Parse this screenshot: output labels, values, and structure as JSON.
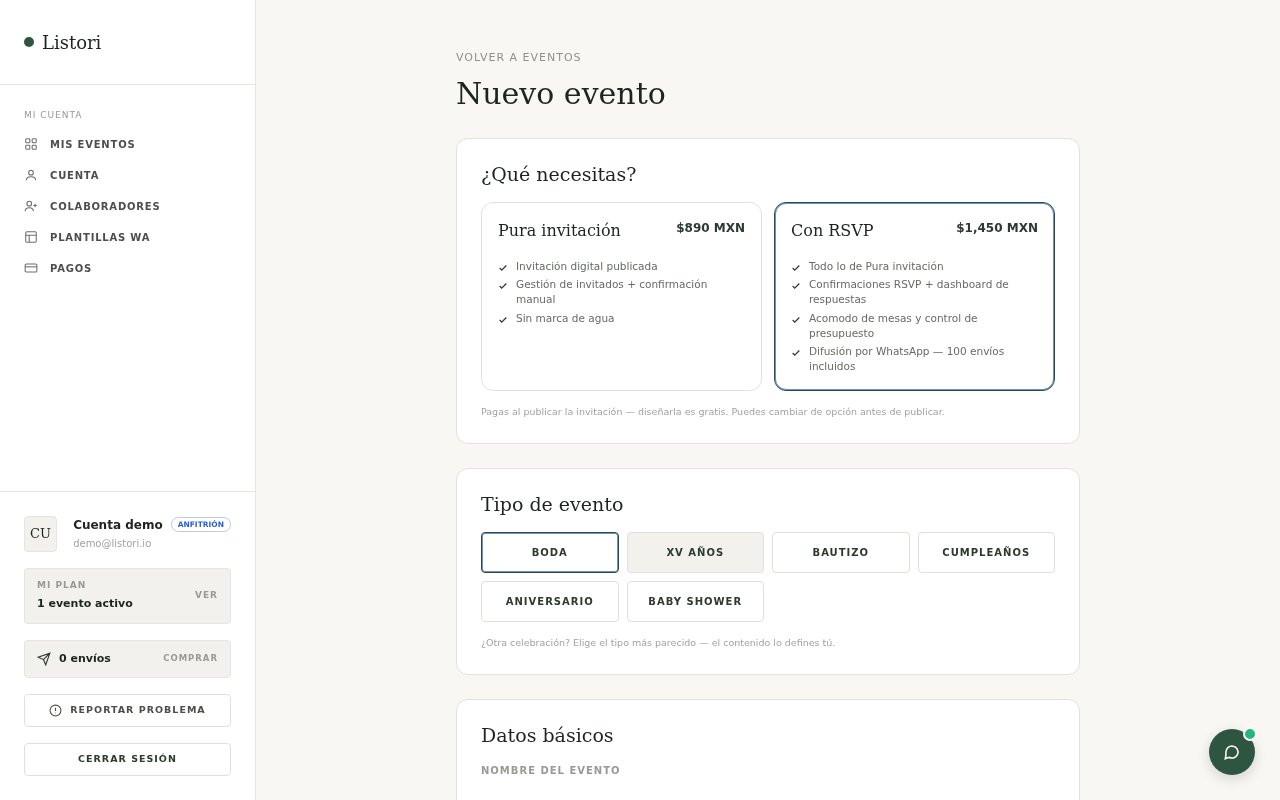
{
  "brand": {
    "name": "Listori"
  },
  "sidebar": {
    "section": "MI CUENTA",
    "items": [
      {
        "label": "MIS EVENTOS"
      },
      {
        "label": "CUENTA"
      },
      {
        "label": "COLABORADORES"
      },
      {
        "label": "PLANTILLAS WA"
      },
      {
        "label": "PAGOS"
      }
    ]
  },
  "account": {
    "initials": "CU",
    "name": "Cuenta demo",
    "role": "ANFITRIÓN",
    "email": "demo@listori.io"
  },
  "plan": {
    "label": "MI PLAN",
    "value": "1 evento activo",
    "action": "VER"
  },
  "sends": {
    "value": "0 envíos",
    "action": "COMPRAR"
  },
  "report_button": "REPORTAR PROBLEMA",
  "logout_button": "CERRAR SESIÓN",
  "back_link": "VOLVER A EVENTOS",
  "title": "Nuevo evento",
  "needs": {
    "title": "¿Qué necesitas?",
    "options": [
      {
        "name": "Pura invitación",
        "price": "$890 MXN",
        "selected": false,
        "features": [
          "Invitación digital publicada",
          "Gestión de invitados + confirmación manual",
          "Sin marca de agua"
        ]
      },
      {
        "name": "Con RSVP",
        "price": "$1,450 MXN",
        "selected": true,
        "features": [
          "Todo lo de Pura invitación",
          "Confirmaciones RSVP + dashboard de respuestas",
          "Acomodo de mesas y control de presupuesto",
          "Difusión por WhatsApp — 100 envíos incluidos"
        ]
      }
    ],
    "note": "Pagas al publicar la invitación — diseñarla es gratis. Puedes cambiar de opción antes de publicar."
  },
  "event_type": {
    "title": "Tipo de evento",
    "options": [
      {
        "label": "BODA",
        "selected": true,
        "highlighted": false
      },
      {
        "label": "XV AÑOS",
        "selected": false,
        "highlighted": true
      },
      {
        "label": "BAUTIZO",
        "selected": false,
        "highlighted": false
      },
      {
        "label": "CUMPLEAÑOS",
        "selected": false,
        "highlighted": false
      },
      {
        "label": "ANIVERSARIO",
        "selected": false,
        "highlighted": false
      },
      {
        "label": "BABY SHOWER",
        "selected": false,
        "highlighted": false
      }
    ],
    "note": "¿Otra celebración? Elige el tipo más parecido — el contenido lo defines tú."
  },
  "basics": {
    "title": "Datos básicos",
    "field_label": "NOMBRE DEL EVENTO"
  },
  "chat": {
    "unread": true
  }
}
